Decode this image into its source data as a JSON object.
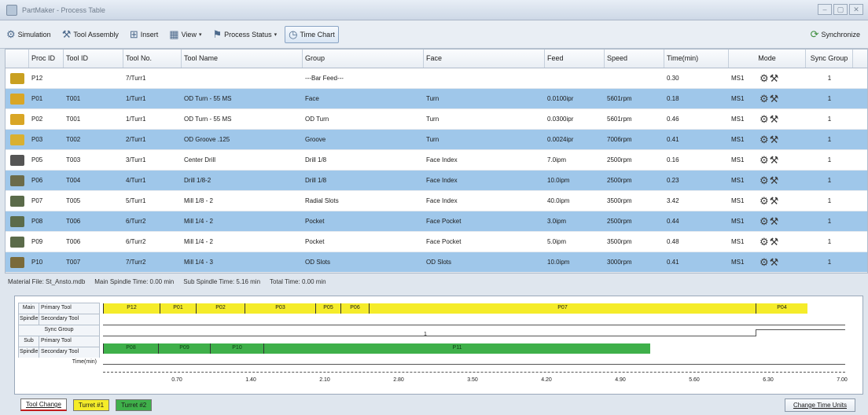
{
  "window": {
    "title": "PartMaker - Process Table",
    "controls": [
      "–",
      "▢",
      "✕"
    ]
  },
  "toolbar": {
    "simulation": "Simulation",
    "tool_assembly": "Tool Assembly",
    "insert": "Insert",
    "view": "View",
    "process_status": "Process Status",
    "time_chart": "Time Chart",
    "synchronize": "Synchronize"
  },
  "table": {
    "headers": [
      "Proc ID",
      "Tool ID",
      "Tool No.",
      "Tool Name",
      "Group",
      "Face",
      "Feed",
      "Speed",
      "Time(min)",
      "Mode",
      "Sync Group"
    ],
    "rows": [
      {
        "proc": "P12",
        "tool_id": "",
        "tool_no": "7/Turr1",
        "tool_name": "",
        "group": "---Bar Feed---",
        "face": "",
        "feed": "",
        "speed": "",
        "time": "0.30",
        "mode": "MS1",
        "sync": "1",
        "selected": false,
        "icon_color": "#c9a021"
      },
      {
        "proc": "P01",
        "tool_id": "T001",
        "tool_no": "1/Turr1",
        "tool_name": "OD Turn - 55 MS",
        "group": "Face",
        "face": "Turn",
        "feed": "0.0100ipr",
        "speed": "5601rpm",
        "time": "0.18",
        "mode": "MS1",
        "sync": "1",
        "selected": true,
        "icon_color": "#d9a625"
      },
      {
        "proc": "P02",
        "tool_id": "T001",
        "tool_no": "1/Turr1",
        "tool_name": "OD Turn - 55 MS",
        "group": "OD Turn",
        "face": "Turn",
        "feed": "0.0300ipr",
        "speed": "5601rpm",
        "time": "0.46",
        "mode": "MS1",
        "sync": "1",
        "selected": false,
        "icon_color": "#d9a625"
      },
      {
        "proc": "P03",
        "tool_id": "T002",
        "tool_no": "2/Turr1",
        "tool_name": "OD Groove .125",
        "group": "Groove",
        "face": "Turn",
        "feed": "0.0024ipr",
        "speed": "7006rpm",
        "time": "0.41",
        "mode": "MS1",
        "sync": "1",
        "selected": true,
        "icon_color": "#d9b030"
      },
      {
        "proc": "P05",
        "tool_id": "T003",
        "tool_no": "3/Turr1",
        "tool_name": "Center Drill",
        "group": "Drill 1/8",
        "face": "Face Index",
        "feed": "7.0ipm",
        "speed": "2500rpm",
        "time": "0.16",
        "mode": "MS1",
        "sync": "1",
        "selected": false,
        "icon_color": "#555555"
      },
      {
        "proc": "P06",
        "tool_id": "T004",
        "tool_no": "4/Turr1",
        "tool_name": "Drill 1/8-2",
        "group": "Drill 1/8",
        "face": "Face Index",
        "feed": "10.0ipm",
        "speed": "2500rpm",
        "time": "0.23",
        "mode": "MS1",
        "sync": "1",
        "selected": true,
        "icon_color": "#6b6b4a"
      },
      {
        "proc": "P07",
        "tool_id": "T005",
        "tool_no": "5/Turr1",
        "tool_name": "Mill 1/8 - 2",
        "group": "Radial Slots",
        "face": "Face Index",
        "feed": "40.0ipm",
        "speed": "3500rpm",
        "time": "3.42",
        "mode": "MS1",
        "sync": "1",
        "selected": false,
        "icon_color": "#5b6b4a"
      },
      {
        "proc": "P08",
        "tool_id": "T006",
        "tool_no": "6/Turr2",
        "tool_name": "Mill 1/4 - 2",
        "group": "Pocket",
        "face": "Face Pocket",
        "feed": "3.0ipm",
        "speed": "2500rpm",
        "time": "0.44",
        "mode": "MS1",
        "sync": "1",
        "selected": true,
        "icon_color": "#5b6b4a"
      },
      {
        "proc": "P09",
        "tool_id": "T006",
        "tool_no": "6/Turr2",
        "tool_name": "Mill 1/4 - 2",
        "group": "Pocket",
        "face": "Face Pocket",
        "feed": "5.0ipm",
        "speed": "3500rpm",
        "time": "0.48",
        "mode": "MS1",
        "sync": "1",
        "selected": false,
        "icon_color": "#5b6b4a"
      },
      {
        "proc": "P10",
        "tool_id": "T007",
        "tool_no": "7/Turr2",
        "tool_name": "Mill 1/4 - 3",
        "group": "OD Slots",
        "face": "OD Slots",
        "feed": "10.0ipm",
        "speed": "3000rpm",
        "time": "0.41",
        "mode": "MS1",
        "sync": "1",
        "selected": true,
        "icon_color": "#7a6a3a"
      }
    ]
  },
  "info": {
    "material": "Material File: St_Ansto.mdb",
    "main_spindle": "Main Spindle Time: 0.00 min",
    "sub_spindle": "Sub Spindle Time: 5.16 min",
    "total": "Total Time: 0.00 min"
  },
  "timechart": {
    "labels": {
      "main": "Main",
      "spindle": "Spindle",
      "sub": "Sub",
      "primary_tool": "Primary Tool",
      "secondary_tool": "Secondary Tool",
      "sync_group": "Sync Group",
      "time": "Time(min)",
      "sync_value": "1"
    },
    "main_primary": [
      "P12",
      "P01",
      "P02",
      "P03",
      "P05",
      "P06",
      "P07",
      "P04"
    ],
    "sub_primary": [
      "P08",
      "P09",
      "P10",
      "P11"
    ],
    "axis": [
      "0.70",
      "1.40",
      "2.10",
      "2.80",
      "3.50",
      "4.20",
      "4.90",
      "5.60",
      "6.30",
      "7.00"
    ]
  },
  "legend": {
    "tool_change": "Tool Change",
    "turret1": "Turret #1",
    "turret2": "Turret #2",
    "change_units": "Change Time Units"
  }
}
